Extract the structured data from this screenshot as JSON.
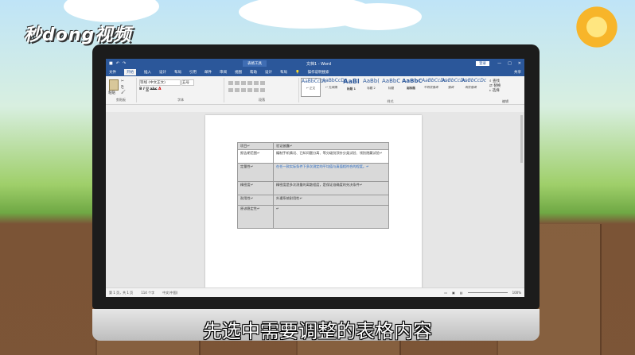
{
  "watermark": "秒dong视频",
  "caption": "先选中需要调整的表格内容",
  "word": {
    "titlebar": {
      "context_tab": "表格工具",
      "doc_title": "文档1 - Word",
      "login": "登录",
      "controls": [
        "—",
        "□",
        "✕"
      ]
    },
    "tabs": [
      "文件",
      "开始",
      "插入",
      "设计",
      "布局",
      "引用",
      "邮件",
      "审阅",
      "视图",
      "帮助",
      "设计",
      "布局"
    ],
    "active_tab": "开始",
    "tell_me": "操作说明搜索",
    "share": "共享",
    "ribbon": {
      "clipboard": {
        "paste": "粘贴",
        "label": "剪贴板"
      },
      "font": {
        "name": "等线 (中文正文)",
        "size": "五号",
        "label": "字体"
      },
      "paragraph": {
        "label": "段落"
      },
      "styles": {
        "label": "样式",
        "items": [
          {
            "preview": "AaBbCcDc",
            "name": "↵ 正文"
          },
          {
            "preview": "AaBbCcDc",
            "name": "↵ 无间隔"
          },
          {
            "preview": "AaBl",
            "name": "标题 1"
          },
          {
            "preview": "AaBb(",
            "name": "标题 2"
          },
          {
            "preview": "AaBbC",
            "name": "标题"
          },
          {
            "preview": "AaBbC",
            "name": "副标题"
          },
          {
            "preview": "AaBbCcDc",
            "name": "不明显强调"
          },
          {
            "preview": "AaBbCcDc",
            "name": "强调"
          },
          {
            "preview": "AaBbCcDc",
            "name": "明显强调"
          }
        ]
      },
      "editing": {
        "find": "查找",
        "replace": "替换",
        "select": "选择",
        "label": "编辑"
      }
    },
    "table": [
      {
        "label": "项目↵",
        "value": "验证披露↵",
        "highlight": true
      },
      {
        "label": "报告期范围↵",
        "value": "编制手机情况、已知问题分离、等分级别顶针分类试验、领别隐藏试验↵",
        "highlight": false
      },
      {
        "label": "定量性↵",
        "value": "在任一款实际条件下多次测定的平均值与真值相符合的程度。↵",
        "highlight": true
      },
      {
        "label": "精密度↵",
        "value": "精密度是多次测量的离散程度，是保证准确度的先决条件↵",
        "highlight": true
      },
      {
        "label": "耐用性↵",
        "value": "外遭系统耐用性↵",
        "highlight": true
      },
      {
        "label": "原谅稳定性↵",
        "value": "↵",
        "highlight": true
      }
    ],
    "status": {
      "page": "第 1 页，共 1 页",
      "words": "114 个字",
      "lang": "中文(中国)",
      "zoom": "100%"
    }
  }
}
